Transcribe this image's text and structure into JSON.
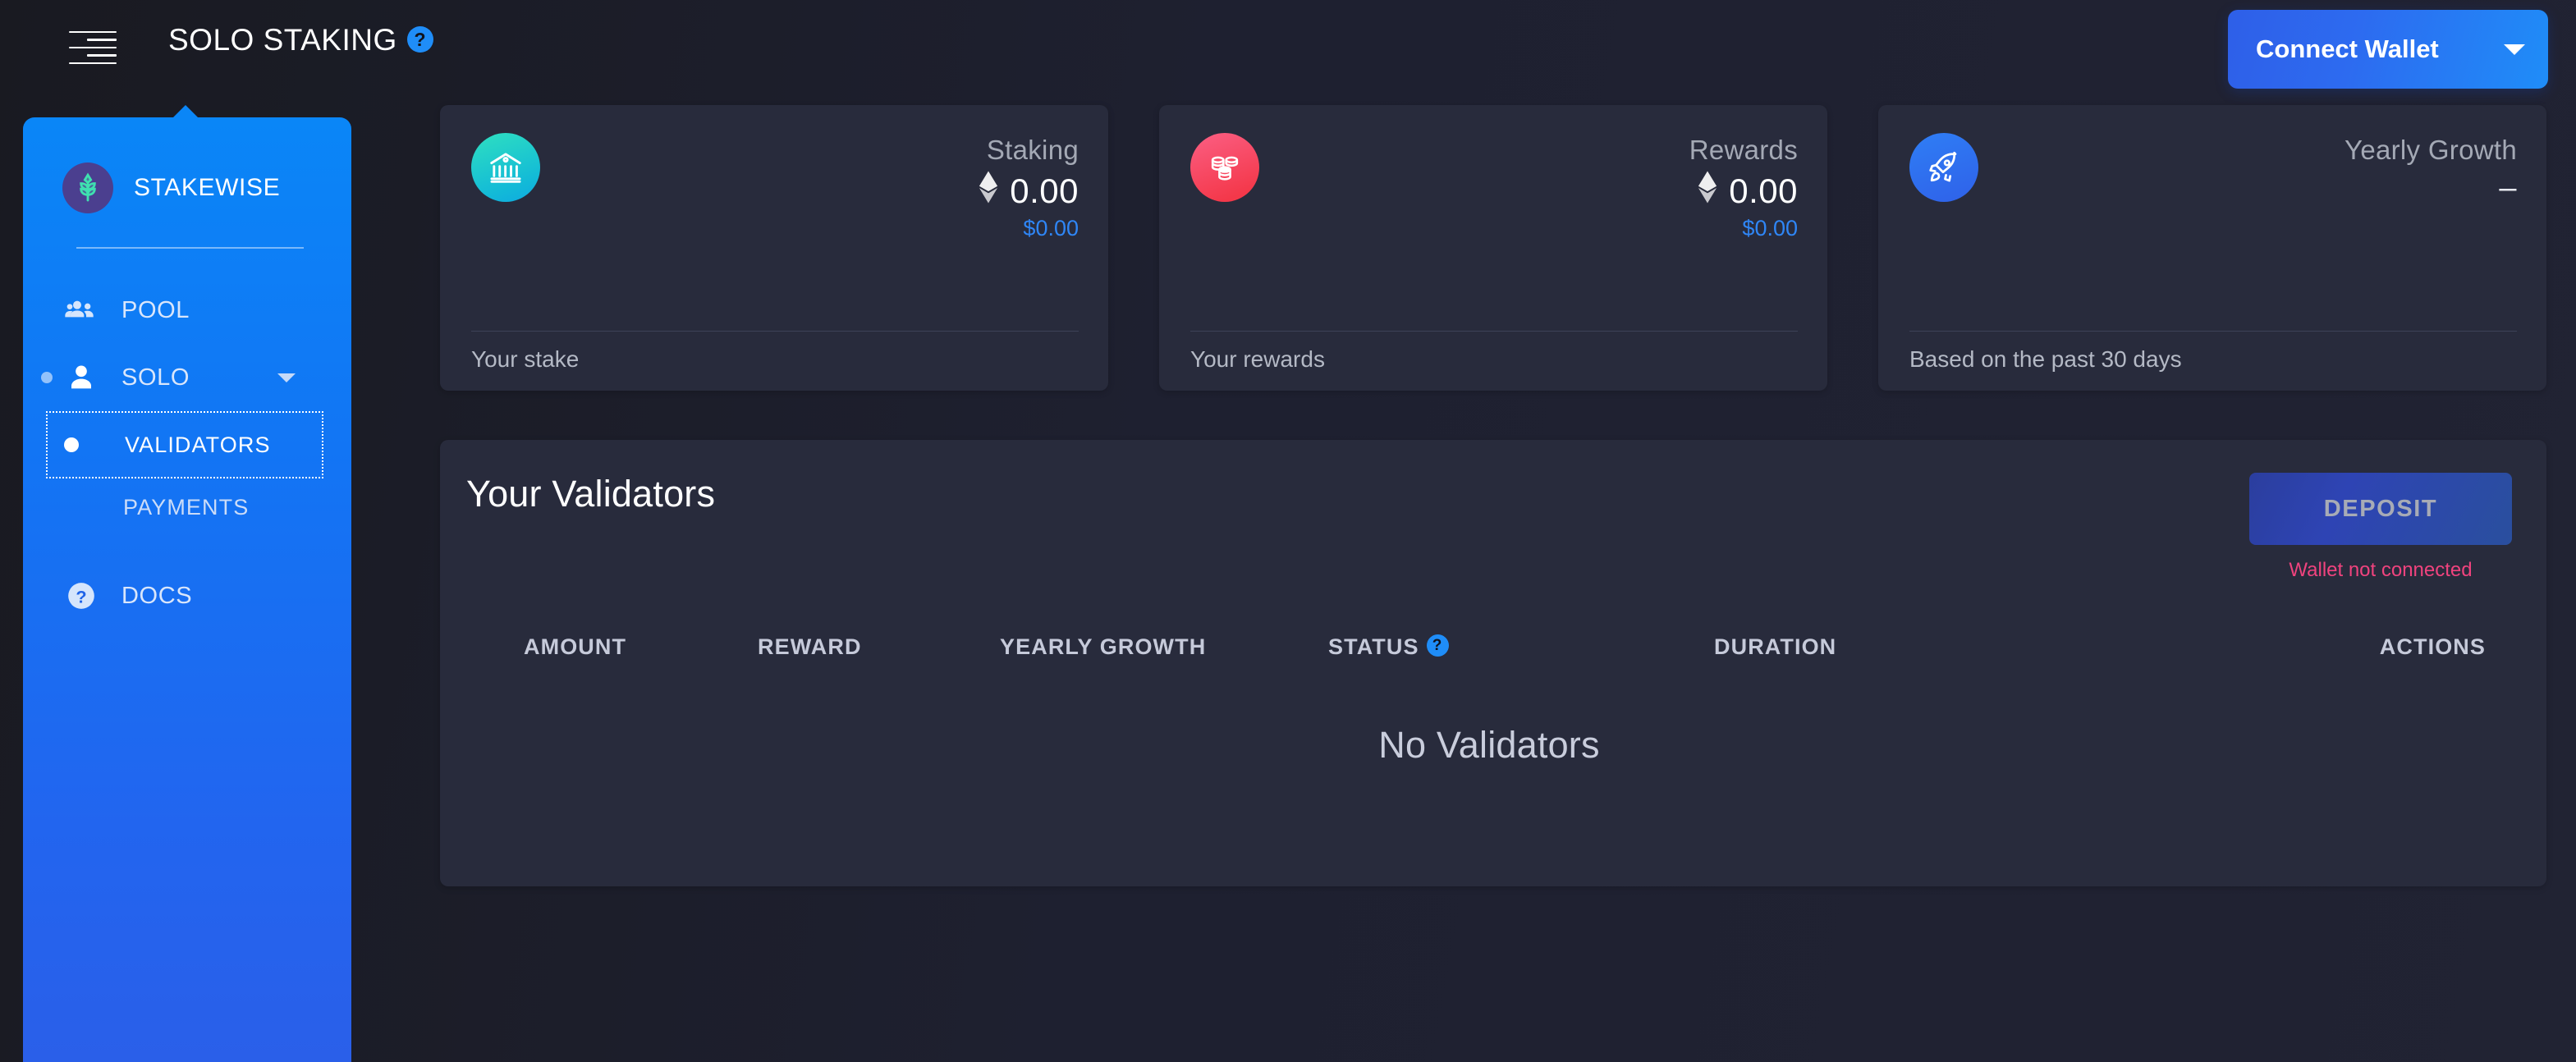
{
  "topbar": {
    "menu_icon": "menu-lines-icon",
    "title": "SOLO STAKING",
    "title_help_icon": "?",
    "connect_wallet_label": "Connect Wallet",
    "connect_wallet_caret_icon": "chevron-down-icon"
  },
  "sidebar": {
    "brand": {
      "name": "STAKEWISE",
      "logo_icon": "stakewise-sprout-logo"
    },
    "items": [
      {
        "label": "POOL",
        "icon": "group-people-icon",
        "active": false,
        "has_chevron": false
      },
      {
        "label": "SOLO",
        "icon": "person-icon",
        "active": true,
        "has_chevron": true
      }
    ],
    "subitems": [
      {
        "label": "VALIDATORS",
        "active": true,
        "focused": true
      },
      {
        "label": "PAYMENTS",
        "active": false,
        "focused": false
      }
    ],
    "docs": {
      "label": "DOCS",
      "icon": "question-circle-icon"
    }
  },
  "stats": [
    {
      "label": "Staking",
      "icon": "bank-building-icon",
      "icon_theme": "teal",
      "currency_icon": "ethereum-diamond-icon",
      "value": "0.00",
      "fiat_value": "$0.00",
      "footer": "Your stake"
    },
    {
      "label": "Rewards",
      "icon": "coin-stack-icon",
      "icon_theme": "red",
      "currency_icon": "ethereum-diamond-icon",
      "value": "0.00",
      "fiat_value": "$0.00",
      "footer": "Your rewards"
    },
    {
      "label": "Yearly Growth",
      "icon": "rocket-icon",
      "icon_theme": "blue",
      "currency_icon": "",
      "value": "–",
      "fiat_value": "",
      "footer": "Based on the past 30 days"
    }
  ],
  "validators_panel": {
    "title": "Your Validators",
    "deposit_button_label": "DEPOSIT",
    "deposit_disabled": true,
    "wallet_warning": "Wallet not connected",
    "columns": [
      "AMOUNT",
      "REWARD",
      "YEARLY GROWTH",
      "STATUS",
      "DURATION",
      "ACTIONS"
    ],
    "status_help_icon": "?",
    "empty_message": "No Validators",
    "rows": []
  },
  "colors": {
    "page_background": "#1e2030",
    "card_background": "#282b3c",
    "sidebar_blue_top": "#0a86f7",
    "sidebar_blue_bottom": "#2a5fe9",
    "accent_blue": "#2f86f6",
    "warning_pink": "#f0437e",
    "muted_text": "#a4a9b5"
  }
}
